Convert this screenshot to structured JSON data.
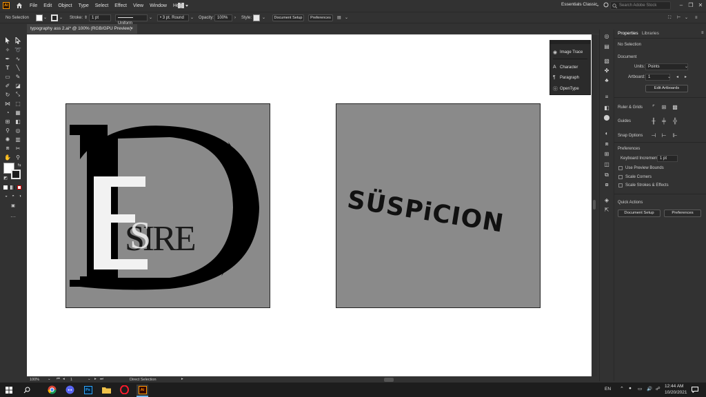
{
  "app": {
    "logo": "Ai",
    "menu": [
      "File",
      "Edit",
      "Object",
      "Type",
      "Select",
      "Effect",
      "View",
      "Window",
      "Help"
    ],
    "workspace": "Essentials Classic",
    "search_placeholder": "Search Adobe Stock"
  },
  "control_bar": {
    "selection": "No Selection",
    "stroke_label": "Stroke:",
    "stroke_value": "1 pt",
    "profile": "Uniform",
    "brush": "3 pt. Round",
    "opacity_label": "Opacity:",
    "opacity_value": "100%",
    "style_label": "Style:",
    "document_setup": "Document Setup",
    "preferences": "Preferences"
  },
  "document": {
    "tab_title": "typography ass 2.ai* @ 100% (RGB/GPU Preview)",
    "close": "×"
  },
  "artboards": {
    "left": {
      "big_letters": "DE",
      "word": "SIRE",
      "word_s": "S"
    },
    "right": {
      "word": "SÜSPiCION"
    }
  },
  "float_panel": {
    "items": [
      {
        "label": "Image Trace",
        "icon": "image-trace-icon"
      },
      {
        "label": "Character",
        "icon": "character-icon"
      },
      {
        "label": "Paragraph",
        "icon": "paragraph-icon"
      },
      {
        "label": "OpenType",
        "icon": "opentype-icon"
      }
    ]
  },
  "properties": {
    "tab_properties": "Properties",
    "tab_libraries": "Libraries",
    "selection": "No Selection",
    "document_heading": "Document",
    "units_label": "Units:",
    "units_value": "Points",
    "artboard_label": "Artboard:",
    "artboard_value": "1",
    "edit_artboards": "Edit Artboards",
    "ruler_grids": "Ruler & Grids",
    "guides": "Guides",
    "snap_options": "Snap Options",
    "preferences_heading": "Preferences",
    "keyboard_increment_label": "Keyboard Increment:",
    "keyboard_increment_value": "1 pt",
    "use_preview_bounds": "Use Preview Bounds",
    "scale_corners": "Scale Corners",
    "scale_strokes": "Scale Strokes & Effects",
    "quick_actions": "Quick Actions",
    "document_setup": "Document Setup",
    "preferences": "Preferences"
  },
  "status_bar": {
    "zoom": "100%",
    "artboard": "1",
    "tool": "Direct Selection"
  },
  "taskbar": {
    "language": "EN",
    "time": "12:44 AM",
    "date": "10/20/2021"
  },
  "colors": {
    "accent": "#ff9a00",
    "artboard_fill": "#8a8a8a",
    "canvas": "#ffffff",
    "ui_bg": "#323232"
  }
}
